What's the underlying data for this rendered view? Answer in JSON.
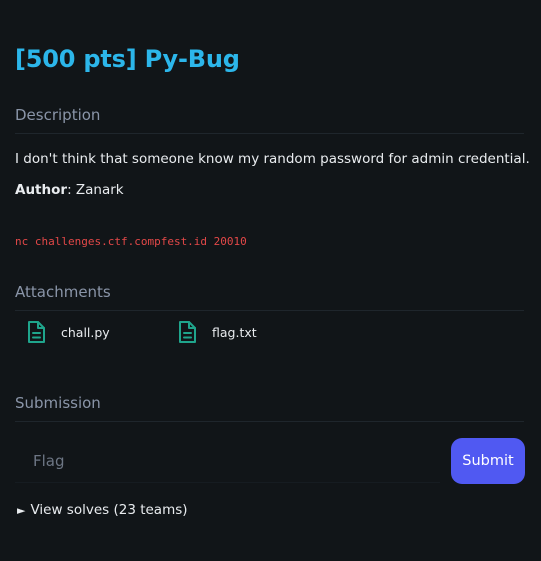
{
  "challenge": {
    "title": "[500 pts] Py-Bug",
    "description_heading": "Description",
    "description": "I don't think that someone know my random password for admin credential.",
    "author_label": "Author",
    "author_name": ": Zanark",
    "command": "nc challenges.ctf.compfest.id 20010"
  },
  "attachments": {
    "heading": "Attachments",
    "items": [
      {
        "name": "chall.py",
        "icon": "file-document-icon"
      },
      {
        "name": "flag.txt",
        "icon": "file-document-icon"
      }
    ]
  },
  "submission": {
    "heading": "Submission",
    "placeholder": "Flag",
    "submit_label": "Submit",
    "solves_toggle": "►",
    "solves_label": "View solves (23 teams)"
  },
  "colors": {
    "background": "#111518",
    "title": "#2cb6ea",
    "command": "#e34848",
    "accent": "#5059f2",
    "file_icon": "#1fa58c"
  }
}
